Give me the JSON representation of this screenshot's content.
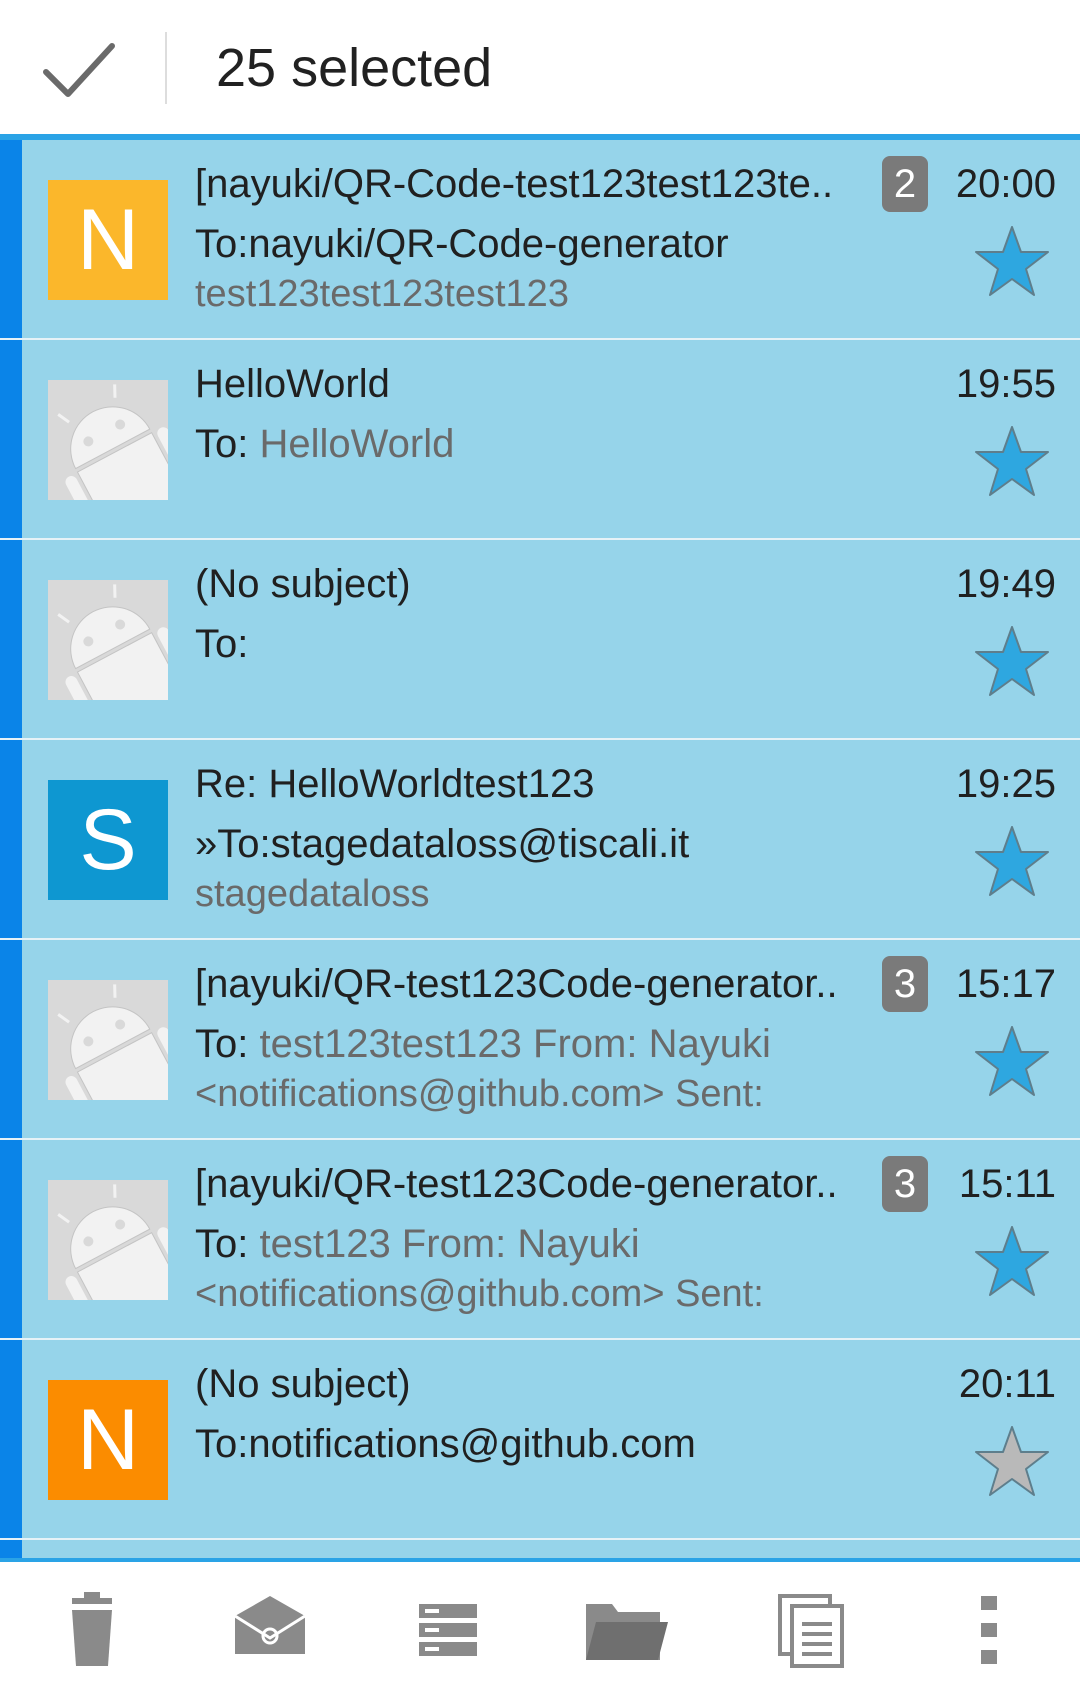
{
  "header": {
    "title": "25 selected"
  },
  "emails": [
    {
      "avatar_letter": "N",
      "avatar_color": "#fbb72b",
      "subject": "[nayuki/QR-Code-test123test123te..",
      "to_prefix": "To:nayuki/QR-Code-generator",
      "to_muted": "",
      "preview": "test123test123test123",
      "preview2": "",
      "badge": "2",
      "time": "20:00",
      "starred": true
    },
    {
      "avatar_letter": "",
      "avatar_color": "",
      "subject": "HelloWorld",
      "to_prefix": "To: ",
      "to_muted": "HelloWorld",
      "preview": "",
      "preview2": "",
      "badge": "",
      "time": "19:55",
      "starred": true
    },
    {
      "avatar_letter": "",
      "avatar_color": "",
      "subject": "(No subject)",
      "to_prefix": "To:",
      "to_muted": "",
      "preview": "",
      "preview2": "",
      "badge": "",
      "time": "19:49",
      "starred": true
    },
    {
      "avatar_letter": "S",
      "avatar_color": "#0e97d1",
      "subject": "Re: HelloWorldtest123",
      "to_prefix": "»To:stagedataloss@tiscali.it",
      "to_muted": "",
      "preview": "stagedataloss",
      "preview2": "",
      "badge": "",
      "time": "19:25",
      "starred": true
    },
    {
      "avatar_letter": "",
      "avatar_color": "",
      "subject": "[nayuki/QR-test123Code-generator..",
      "to_prefix": "To: ",
      "to_muted": "test123test123 From: Nayuki",
      "preview": "<notifications@github.com> Sent:",
      "preview2": "",
      "badge": "3",
      "time": "15:17",
      "starred": true
    },
    {
      "avatar_letter": "",
      "avatar_color": "",
      "subject": "[nayuki/QR-test123Code-generator..",
      "to_prefix": "To: ",
      "to_muted": "test123 From: Nayuki",
      "preview": "<notifications@github.com> Sent:",
      "preview2": "",
      "badge": "3",
      "time": "15:11",
      "starred": true
    },
    {
      "avatar_letter": "N",
      "avatar_color": "#fb8c00",
      "subject": "(No subject)",
      "to_prefix": "To:notifications@github.com",
      "to_muted": "",
      "preview": "",
      "preview2": "",
      "badge": "",
      "time": "20:11",
      "starred": false
    }
  ],
  "colors": {
    "selected_row_bg": "#96d4ea",
    "selection_bar": "#0a84e8",
    "star_on": "#2ea7e0",
    "star_off": "#b9b9b9",
    "badge_bg": "#7a7a7a"
  },
  "bottom_actions": [
    {
      "name": "delete-icon"
    },
    {
      "name": "mark-read-icon"
    },
    {
      "name": "move-to-list-icon"
    },
    {
      "name": "folder-icon"
    },
    {
      "name": "copy-icon"
    },
    {
      "name": "more-options-icon"
    }
  ]
}
